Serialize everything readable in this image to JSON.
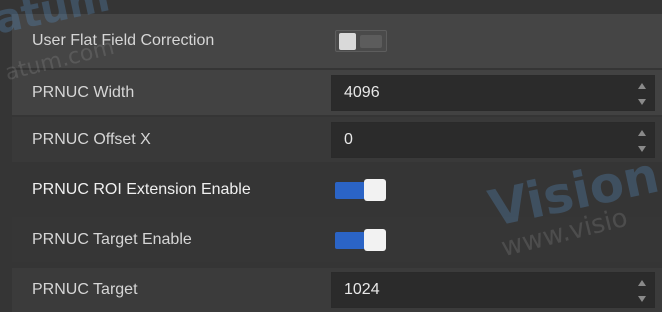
{
  "watermark": {
    "top_left_main": "atum",
    "top_left_sub": "atum.com",
    "bottom_right_main": "Vision",
    "bottom_right_sub": "www.visio"
  },
  "properties": [
    {
      "label": "User Flat Field Correction",
      "type": "toggle",
      "state": "off"
    },
    {
      "label": "PRNUC Width",
      "type": "number",
      "value": "4096"
    },
    {
      "label": "PRNUC Offset X",
      "type": "number",
      "value": "0"
    },
    {
      "label": "PRNUC ROI Extension Enable",
      "type": "toggle",
      "state": "on"
    },
    {
      "label": "PRNUC Target Enable",
      "type": "toggle",
      "state": "on"
    },
    {
      "label": "PRNUC Target",
      "type": "number",
      "value": "1024"
    }
  ],
  "colors": {
    "background": "#353535",
    "toggle_on": "#2b64c6",
    "field": "#2b2b2b",
    "text": "#d6d6d6"
  }
}
